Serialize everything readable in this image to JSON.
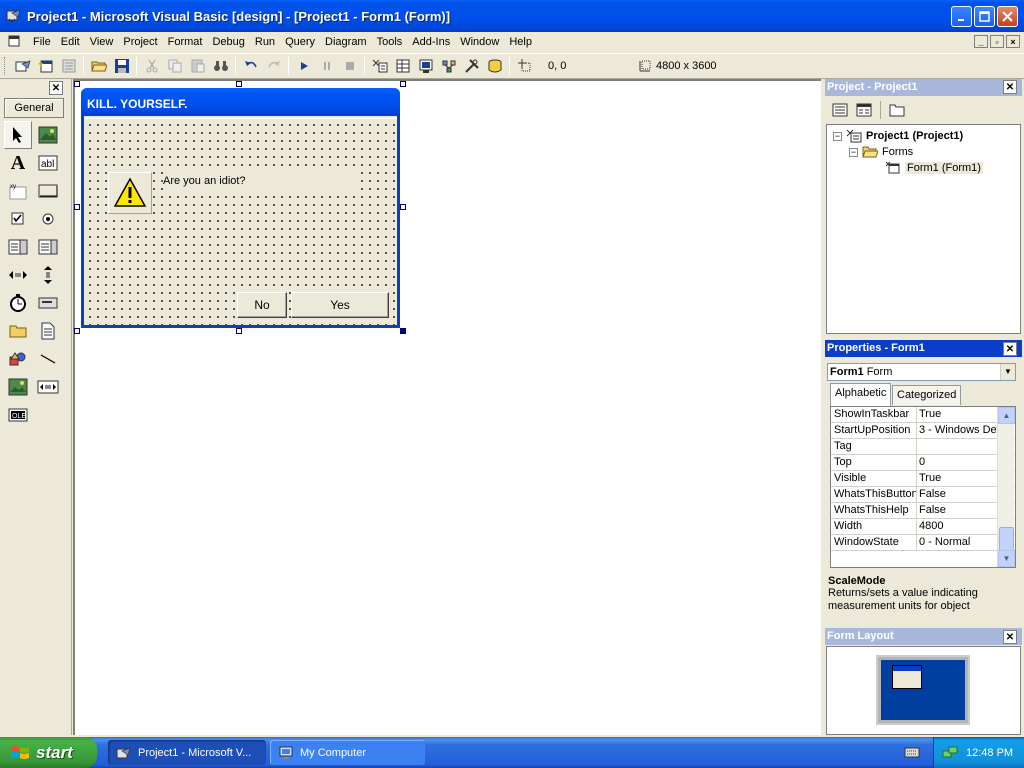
{
  "window": {
    "title": "Project1 - Microsoft Visual Basic [design] - [Project1 - Form1 (Form)]",
    "buttons": [
      "minimize-icon",
      "maximize-icon",
      "close-icon"
    ]
  },
  "menu": {
    "items": [
      "File",
      "Edit",
      "View",
      "Project",
      "Format",
      "Debug",
      "Run",
      "Query",
      "Diagram",
      "Tools",
      "Add-Ins",
      "Window",
      "Help"
    ]
  },
  "toolbar": {
    "position": "0, 0",
    "size": "4800 x 3600"
  },
  "toolbox": {
    "tab_label": "General",
    "tools": [
      "pointer",
      "picturebox",
      "label",
      "textbox",
      "frame",
      "commandbutton",
      "checkbox",
      "optionbutton",
      "combobox",
      "listbox",
      "hscrollbar",
      "vscrollbar",
      "timer",
      "drivelistbox",
      "dirlistbox",
      "filelistbox",
      "shape",
      "line",
      "image",
      "data",
      "ole"
    ]
  },
  "form": {
    "caption": "KILL. YOURSELF.",
    "question": "Are you an idiot?",
    "button_no": "No",
    "button_yes": "Yes",
    "icon": "warning-icon"
  },
  "project_panel": {
    "title": "Project - Project1",
    "tree": {
      "project": "Project1 (Project1)",
      "folder": "Forms",
      "form": "Form1 (Form1)"
    }
  },
  "properties_panel": {
    "title": "Properties - Form1",
    "object_name": "Form1",
    "object_type": "Form",
    "tabs": [
      "Alphabetic",
      "Categorized"
    ],
    "rows": [
      {
        "name": "ShowInTaskbar",
        "value": "True"
      },
      {
        "name": "StartUpPosition",
        "value": "3 - Windows Def"
      },
      {
        "name": "Tag",
        "value": ""
      },
      {
        "name": "Top",
        "value": "0"
      },
      {
        "name": "Visible",
        "value": "True"
      },
      {
        "name": "WhatsThisButton",
        "value": "False"
      },
      {
        "name": "WhatsThisHelp",
        "value": "False"
      },
      {
        "name": "Width",
        "value": "4800"
      },
      {
        "name": "WindowState",
        "value": "0 - Normal"
      }
    ],
    "desc_name": "ScaleMode",
    "desc_text": "Returns/sets a value indicating measurement units for object"
  },
  "layout_panel": {
    "title": "Form Layout"
  },
  "taskbar": {
    "start_label": "start",
    "tasks": [
      {
        "label": "Project1 - Microsoft V...",
        "active": true
      },
      {
        "label": "My Computer",
        "active": false
      }
    ],
    "clock": "12:48 PM"
  },
  "colors": {
    "titlebar": "#0050ee",
    "active_panel": "#0a3dc8",
    "inactive_panel": "#a9b7db",
    "start_green": "#3c9b3c"
  }
}
